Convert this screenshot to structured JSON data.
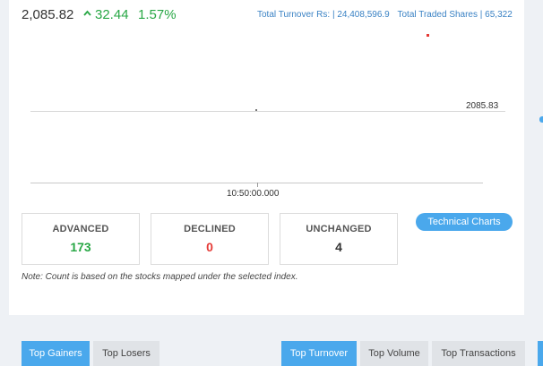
{
  "index": {
    "value": "2,085.82",
    "change_points": "32.44",
    "change_percent": "1.57%"
  },
  "turnover": {
    "turnover_label": "Total Turnover Rs:",
    "turnover_value": "24,408,596.9",
    "shares_label": "Total Traded Shares",
    "shares_value": "65,322"
  },
  "chart_data": {
    "type": "line",
    "x": [
      "10:50:00.000"
    ],
    "series": [
      {
        "values": [
          2085.83
        ]
      }
    ],
    "price_label": "2085.83",
    "time_label": "10:50:00.000"
  },
  "stats": {
    "advanced": {
      "label": "ADVANCED",
      "value": "173"
    },
    "declined": {
      "label": "DECLINED",
      "value": "0"
    },
    "unchanged": {
      "label": "UNCHANGED",
      "value": "4"
    }
  },
  "technical_charts_label": "Technical Charts",
  "note": "Note: Count is based on the stocks mapped under the selected index.",
  "tabs_left": [
    {
      "label": "Top Gainers",
      "active": true
    },
    {
      "label": "Top Losers",
      "active": false
    }
  ],
  "tabs_right": [
    {
      "label": "Top Turnover",
      "active": true
    },
    {
      "label": "Top Volume",
      "active": false
    },
    {
      "label": "Top Transactions",
      "active": false
    }
  ],
  "colors": {
    "up": "#28a745",
    "down": "#e53935",
    "accent": "#4aa8ec",
    "link": "#3a82c4"
  }
}
